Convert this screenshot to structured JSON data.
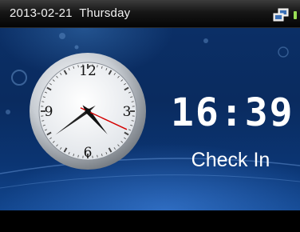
{
  "status_bar": {
    "date": "2013-02-21",
    "weekday": "Thursday",
    "network_icon": "network-connection-icon",
    "indicator_color": "#9adf55"
  },
  "clock": {
    "numerals": [
      "12",
      "3",
      "6",
      "9"
    ],
    "hour": 16,
    "minute": 39,
    "second_hand_color": "#d40000"
  },
  "digital_time": "16:39",
  "status_label": "Check In",
  "colors": {
    "background_top": "#0b2f66",
    "background_bottom": "#12468e",
    "text": "#ffffff"
  }
}
